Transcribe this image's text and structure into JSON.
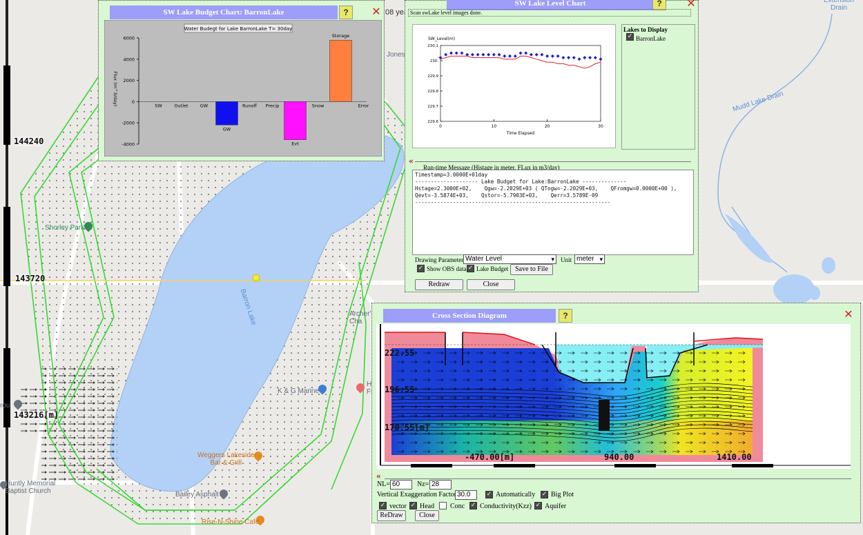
{
  "map": {
    "labels": {
      "extension_drain": "Extension\nDrain",
      "mudd_lake_drain": "Mudd Lake Drain",
      "barron_lake": "Barron Lake",
      "shorley_park": "Shorley Park",
      "kg_marine": "K & G Marine",
      "weggers": "Weggers Lakeside\nBar & Grill",
      "bailey_asphalt": "Bailey Asphalt",
      "rise_n_shine": "Rise-N-Shine Cafe",
      "memorial_church": "Huntly Memorial\nBaptist Church",
      "archers": "Archer's\nCha",
      "jones": "Jones",
      "years_fragment": "08 yea",
      "hf_fragment": "H\nFi",
      "rou_fragment": "rou",
      "n_fragment": "n"
    },
    "coords": {
      "top": "144240",
      "mid": "143720",
      "bottom": "143216[m]"
    }
  },
  "budget_window": {
    "title": "SW Lake Budget Chart: BarronLake",
    "help": "?",
    "close": "✕",
    "chart_data": {
      "type": "bar",
      "title": "Water Budegt for Lake BarronLake T= 30day",
      "ylabel": "Flux (m^3/day)",
      "ylim": [
        -4000,
        6000
      ],
      "yticks": [
        -4000,
        -2000,
        0,
        2000,
        4000,
        6000
      ],
      "categories": [
        "SW",
        "Outlet",
        "GW",
        "GW",
        "Runoff",
        "Precip",
        "Evt",
        "Snow",
        "Storage",
        "Error"
      ],
      "values": [
        0,
        0,
        0,
        -2202.9,
        0,
        0,
        -3587.4,
        0,
        5790.3,
        0
      ],
      "colors": [
        "#888888",
        "#888888",
        "#888888",
        "#1010ee",
        "#888888",
        "#888888",
        "#ff10ff",
        "#888888",
        "#ff7f3f",
        "#888888"
      ]
    }
  },
  "level_window": {
    "title": "SW Lake Level Chart",
    "help": "?",
    "close": "✕",
    "status": "Scan swLake level images done.",
    "lakes_header": "Lakes to Display",
    "lake_option": "BarronLake",
    "message_header": "Run-time Message (Histage in meter, FLux in m3/day)",
    "message_lines": [
      "Timestamp=3.0000E+01day",
      "-------------------- Lake Budget for Lake:BarronLake --------------",
      "Hstage=2.3000E+02,    Qgw=-2.2029E+03 ( QTogw=-2.2029E+03,    QFromgw=0.0000E+00 ),",
      "Qevt=-3.5874E+03,    Qstor=-5.7903E+03,    Qerr=3.5789E-09",
      "--------------------------------------------------------------"
    ],
    "drawing_param_label": "Drawing Parameter",
    "drawing_param_value": "Water Level",
    "unit_label": "Unit",
    "unit_value": "meter",
    "show_obs_label": "Show OBS data",
    "lake_budget_label": "Lake Budget",
    "save_label": "Save to File",
    "redraw_label": "Redraw",
    "close_label": "Close",
    "chart_data": {
      "type": "line",
      "ylabel": "SW_Level(m)",
      "xlabel": "Time Elapsed",
      "xlim": [
        0,
        30
      ],
      "ylim": [
        229.6,
        230.1
      ],
      "xticks": [
        0,
        10,
        20,
        30
      ],
      "yticks": [
        229.6,
        229.7,
        229.8,
        229.9,
        230.0,
        230.1
      ],
      "ytick_labels": [
        "229.6",
        "229.7",
        "229.8",
        "229.9",
        "230.",
        "230.1"
      ],
      "series": [
        {
          "kind": "line",
          "color": "#e02020",
          "x": [
            0,
            1,
            2,
            3,
            4,
            5,
            6,
            7,
            8,
            9,
            10,
            11,
            12,
            13,
            14,
            15,
            16,
            17,
            18,
            19,
            20,
            21,
            22,
            23,
            24,
            25,
            26,
            27,
            28,
            29,
            30
          ],
          "y": [
            230.01,
            230.02,
            230.03,
            230.03,
            230.03,
            230.03,
            230.02,
            230.02,
            230.02,
            230.02,
            230.02,
            230.02,
            230.01,
            230.01,
            230.01,
            230.03,
            230.03,
            230.02,
            230.01,
            230.0,
            229.99,
            229.99,
            229.98,
            229.98,
            229.97,
            229.97,
            229.96,
            229.95,
            229.96,
            229.98,
            229.99
          ]
        },
        {
          "kind": "scatter",
          "color": "#2020cc",
          "x": [
            0,
            1,
            2,
            3,
            4,
            5,
            6,
            7,
            8,
            9,
            10,
            11,
            12,
            13,
            14,
            15,
            16,
            17,
            18,
            19,
            20,
            21,
            22,
            23,
            24,
            25,
            26,
            27,
            28,
            29,
            30
          ],
          "y": [
            230.02,
            230.04,
            230.05,
            230.05,
            230.05,
            230.04,
            230.04,
            230.04,
            230.04,
            230.04,
            230.04,
            230.04,
            230.03,
            230.03,
            230.03,
            230.05,
            230.05,
            230.04,
            230.04,
            230.04,
            230.03,
            230.03,
            230.03,
            230.02,
            230.02,
            230.02,
            230.01,
            230.02,
            230.02,
            230.02,
            230.01
          ]
        }
      ]
    }
  },
  "cross_window": {
    "title": "Cross Section Diagram",
    "help": "?",
    "close": "✕",
    "depth_labels": [
      "222.55",
      "196.55",
      "170.55[m]"
    ],
    "x_labels": [
      "-470.00[m]",
      "940.00",
      "1410.00"
    ],
    "nl_label": "NL=",
    "nl_value": "60",
    "nz_label": "Nz=",
    "nz_value": "28",
    "vef_label": "Vertical Exaggeration Factor",
    "vef_value": "30.0",
    "auto_label": "Automatically",
    "bigplot_label": "Big Plot",
    "vector_label": "vector",
    "head_label": "Head",
    "conc_label": "Conc",
    "cond_label": "Conductivity(Kzz)",
    "aquifer_label": "Aquifer",
    "redraw_label": "ReDraw",
    "close_label": "Close"
  }
}
